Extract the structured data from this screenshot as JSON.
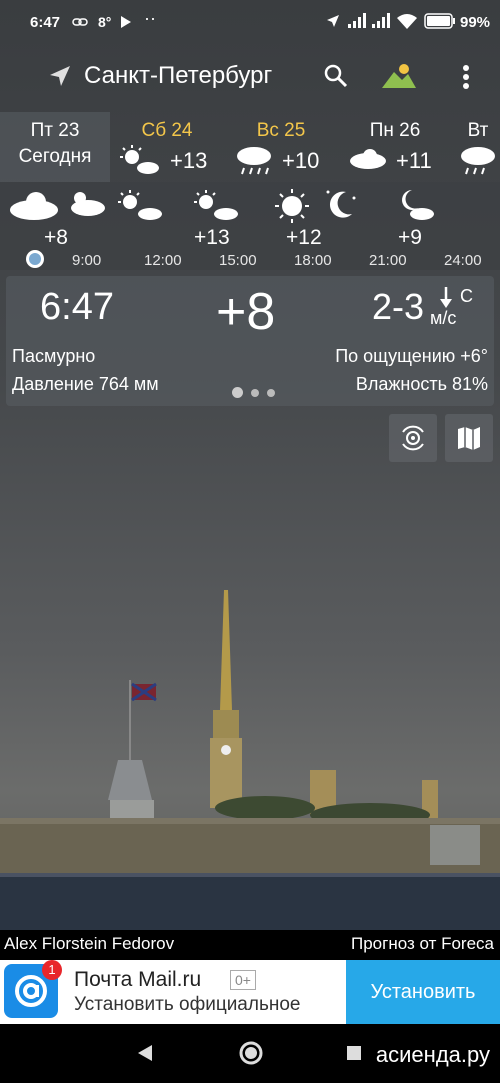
{
  "status_bar": {
    "time": "6:47",
    "temp": "8°",
    "battery": "99%"
  },
  "header": {
    "city": "Санкт-Петербург"
  },
  "days": [
    {
      "name": "Пт 23",
      "sub": "Сегодня",
      "temp": "",
      "weekend": false,
      "active": true
    },
    {
      "name": "Сб 24",
      "sub": "",
      "temp": "+13",
      "weekend": true,
      "icon": "sun-cloud-icon"
    },
    {
      "name": "Вс 25",
      "sub": "",
      "temp": "+10",
      "weekend": true,
      "icon": "rain-icon"
    },
    {
      "name": "Пн 26",
      "sub": "",
      "temp": "+11",
      "weekend": false,
      "icon": "cloud-icon"
    },
    {
      "name": "Вт",
      "sub": "",
      "temp": "",
      "weekend": false,
      "icon": "rain-icon"
    }
  ],
  "hourly": {
    "times": [
      "9:00",
      "12:00",
      "15:00",
      "18:00",
      "21:00",
      "24:00"
    ],
    "temps": [
      "+8",
      "+13",
      "+12",
      "+9"
    ]
  },
  "current": {
    "time": "6:47",
    "temp": "+8",
    "wind": "2-3",
    "wind_dir": "С",
    "wind_unit": "м/с",
    "condition": "Пасмурно",
    "feels_like": "По ощущению +6°",
    "pressure": "Давление 764 мм",
    "humidity": "Влажность 81%"
  },
  "credits": {
    "photo": "Alex Florstein Fedorov",
    "source": "Прогноз от Foreca"
  },
  "ad": {
    "title": "Почта Mail.ru",
    "age": "0+",
    "subtitle": "Установить официальное",
    "badge": "1",
    "button": "Установить"
  },
  "watermark": "асиенда.ру",
  "colors": {
    "weekend": "#f3c64a",
    "install": "#27a8e8",
    "logo": "#1a8ce6"
  }
}
